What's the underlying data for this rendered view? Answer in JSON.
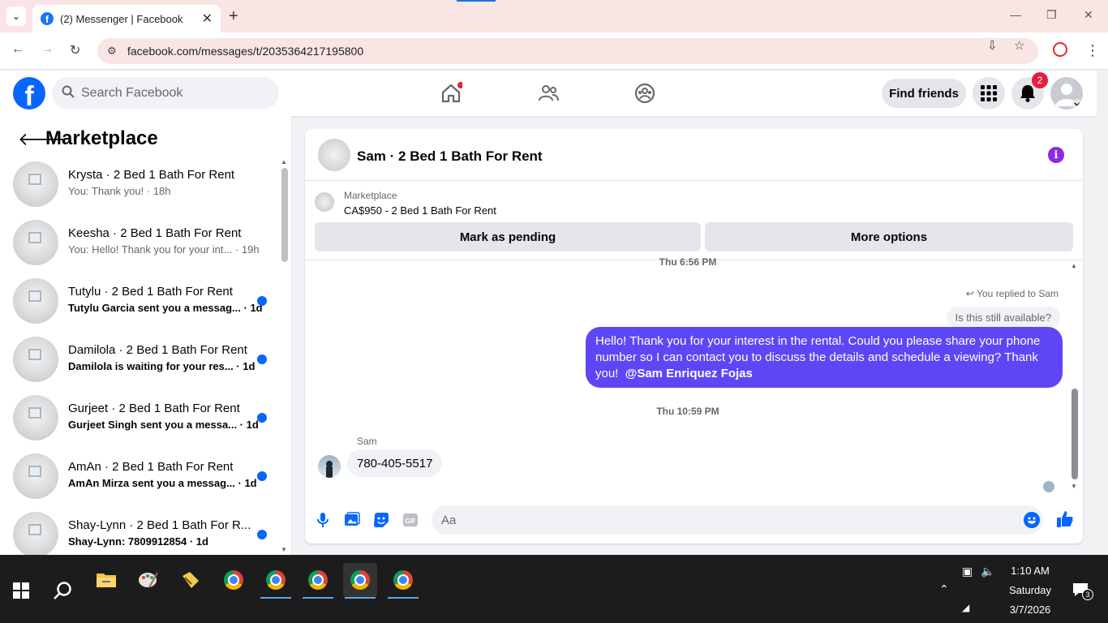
{
  "browser": {
    "tab_title": "(2) Messenger | Facebook",
    "url": "facebook.com/messages/t/2035364217195800"
  },
  "header": {
    "search_placeholder": "Search Facebook",
    "find_friends": "Find friends",
    "notification_count": "2"
  },
  "left_panel": {
    "title": "Marketplace",
    "conversations": [
      {
        "name": "Krysta · 2 Bed 1 Bath For Rent",
        "snippet": "You: Thank you! · 18h",
        "unread": false
      },
      {
        "name": "Keesha · 2 Bed 1 Bath For Rent",
        "snippet": "You: Hello! Thank you for your int... · 19h",
        "unread": false
      },
      {
        "name": "Tutylu · 2 Bed 1 Bath For Rent",
        "snippet": "Tutylu Garcia sent you a messag... · 1d",
        "unread": true
      },
      {
        "name": "Damilola · 2 Bed 1 Bath For Rent",
        "snippet": "Damilola is waiting for your res... · 1d",
        "unread": true
      },
      {
        "name": "Gurjeet · 2 Bed 1 Bath For Rent",
        "snippet": "Gurjeet Singh sent you a messa... · 1d",
        "unread": true
      },
      {
        "name": "AmAn · 2 Bed 1 Bath For Rent",
        "snippet": "AmAn Mirza sent you a messag... · 1d",
        "unread": true
      },
      {
        "name": "Shay-Lynn · 2 Bed 1 Bath For R...",
        "snippet": "Shay-Lynn: 7809912854 · 1d",
        "unread": true
      }
    ]
  },
  "chat": {
    "title": "Sam · 2 Bed 1 Bath For Rent",
    "marketplace_label": "Marketplace",
    "listing": "CA$950 - 2 Bed 1 Bath For Rent",
    "mark_pending": "Mark as pending",
    "more_options": "More options",
    "timestamp_top": "Thu 6:56 PM",
    "replied_label": "You replied to Sam",
    "quoted_text": "Is this still available?",
    "outgoing_text": "Hello! Thank you for your interest in the rental. Could you please share your phone number so I can contact you to discuss the details and schedule a viewing? Thank you!",
    "outgoing_mention": "@Sam Enriquez Fojas",
    "timestamp_2": "Thu 10:59 PM",
    "sender_name": "Sam",
    "incoming_text": "780-405-5517",
    "composer_placeholder": "Aa"
  },
  "taskbar": {
    "time": "1:10 AM",
    "day": "Saturday",
    "date": "3/7/2026",
    "notif_count": "3"
  },
  "colors": {
    "fb_blue": "#0866ff",
    "outgoing_bubble": "#5d47f5",
    "unread_dot": "#0866ff"
  }
}
